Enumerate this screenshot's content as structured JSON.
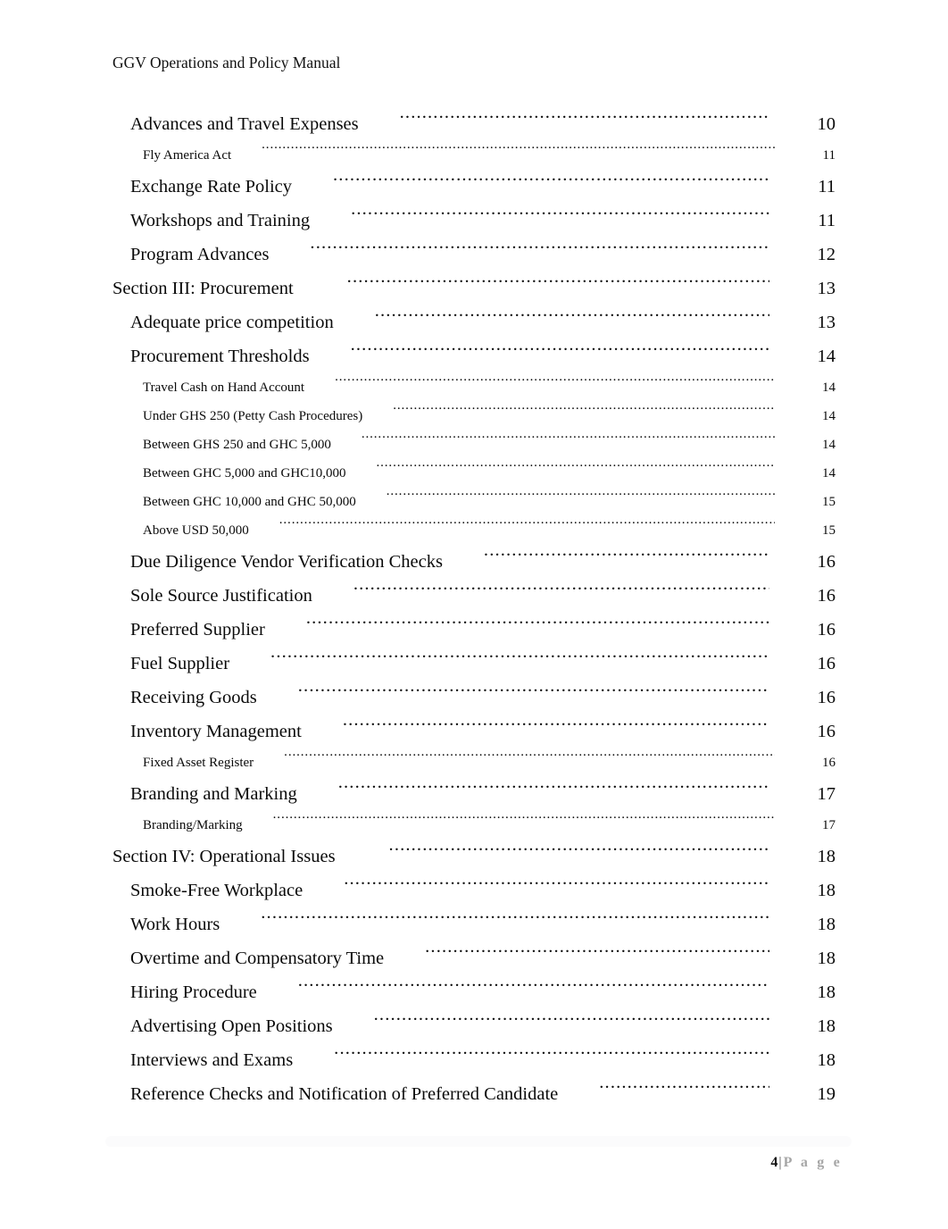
{
  "document": {
    "header": "GGV Operations and Policy Manual"
  },
  "toc": {
    "entries": [
      {
        "level": 1,
        "title": "Advances and Travel Expenses",
        "page": "10"
      },
      {
        "level": 2,
        "title": "Fly America Act",
        "page": "11"
      },
      {
        "level": 1,
        "title": "Exchange Rate Policy",
        "page": "11"
      },
      {
        "level": 1,
        "title": "Workshops and Training",
        "page": "11"
      },
      {
        "level": 1,
        "title": "Program Advances",
        "page": "12"
      },
      {
        "level": 0,
        "title": "Section III: Procurement",
        "page": "13"
      },
      {
        "level": 1,
        "title": "Adequate price competition",
        "page": "13"
      },
      {
        "level": 1,
        "title": "Procurement Thresholds",
        "page": "14"
      },
      {
        "level": 2,
        "title": "Travel Cash on Hand Account",
        "page": "14"
      },
      {
        "level": 2,
        "title": "Under GHS 250 (Petty Cash Procedures)",
        "page": "14"
      },
      {
        "level": 2,
        "title": "Between GHS 250 and GHC 5,000",
        "page": "14"
      },
      {
        "level": 2,
        "title": "Between GHC 5,000 and GHC10,000",
        "page": "14"
      },
      {
        "level": 2,
        "title": "Between GHC 10,000 and GHC 50,000",
        "page": "15"
      },
      {
        "level": 2,
        "title": "Above USD 50,000",
        "page": "15"
      },
      {
        "level": 1,
        "title": "Due Diligence Vendor Verification Checks",
        "page": "16"
      },
      {
        "level": 1,
        "title": "Sole Source Justification",
        "page": "16"
      },
      {
        "level": 1,
        "title": "Preferred Supplier",
        "page": "16"
      },
      {
        "level": 1,
        "title": "Fuel Supplier",
        "page": "16"
      },
      {
        "level": 1,
        "title": "Receiving Goods",
        "page": "16"
      },
      {
        "level": 1,
        "title": "Inventory Management",
        "page": "16"
      },
      {
        "level": 2,
        "title": "Fixed Asset Register",
        "page": "16"
      },
      {
        "level": 1,
        "title": "Branding and Marking",
        "page": "17"
      },
      {
        "level": 2,
        "title": "Branding/Marking",
        "page": "17"
      },
      {
        "level": 0,
        "title": "Section IV: Operational Issues",
        "page": "18"
      },
      {
        "level": 1,
        "title": "Smoke-Free Workplace",
        "page": "18"
      },
      {
        "level": 1,
        "title": "Work Hours",
        "page": "18"
      },
      {
        "level": 1,
        "title": "Overtime and Compensatory Time",
        "page": "18"
      },
      {
        "level": 1,
        "title": "Hiring Procedure",
        "page": "18"
      },
      {
        "level": 1,
        "title": "Advertising Open Positions",
        "page": "18"
      },
      {
        "level": 1,
        "title": "Interviews and Exams",
        "page": "18"
      },
      {
        "level": 1,
        "title": "Reference Checks and Notification of Preferred Candidate",
        "page": "19"
      }
    ]
  },
  "footer": {
    "page_number": "4",
    "separator": "|",
    "page_word": "P a g e"
  }
}
